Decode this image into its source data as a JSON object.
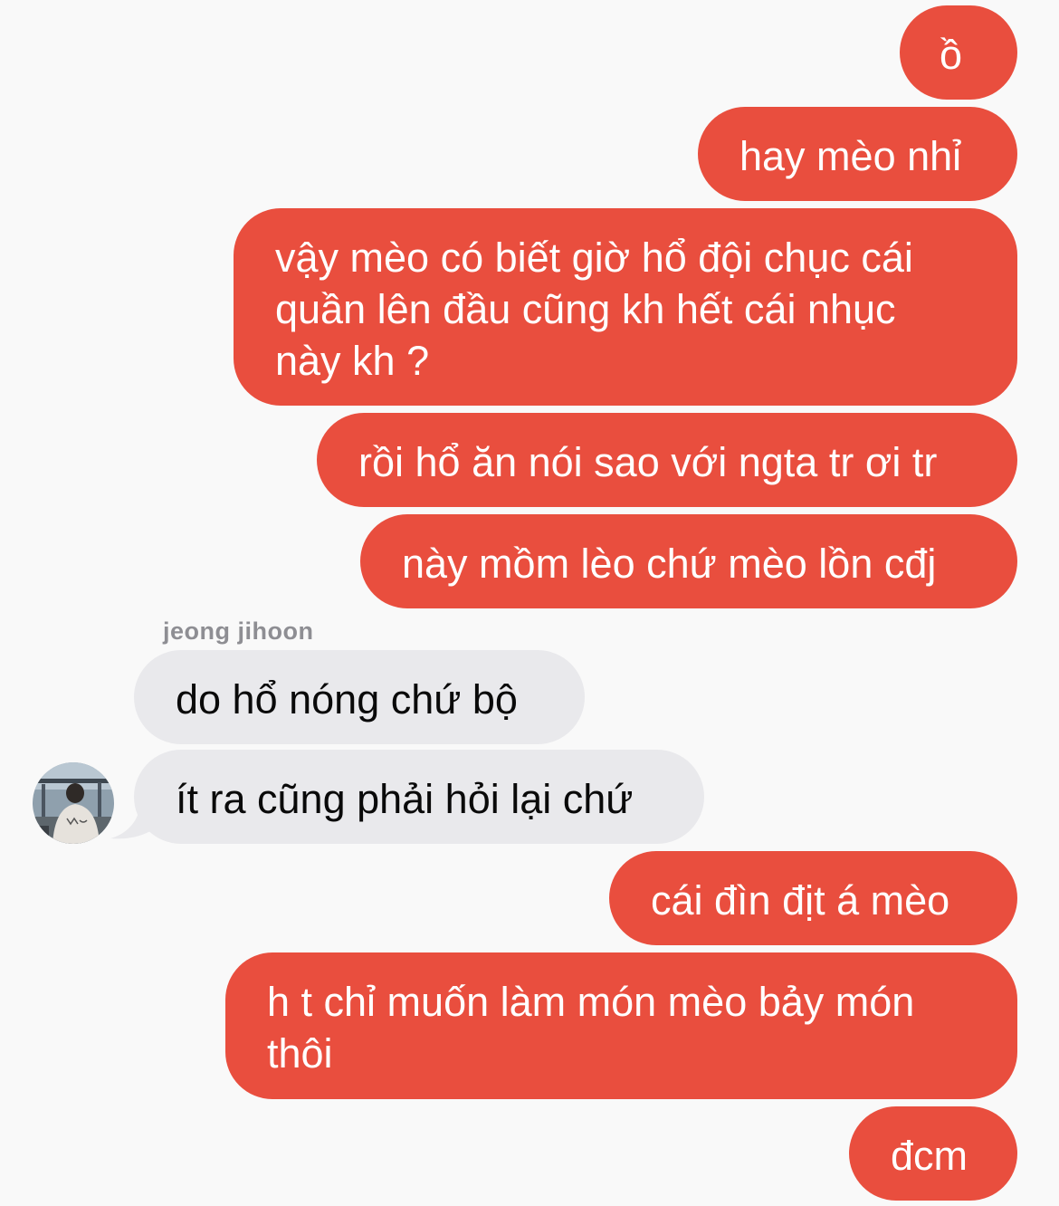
{
  "conversation": {
    "contact_name": "jeong jihoon",
    "messages": [
      {
        "from": "me",
        "text": "ồ"
      },
      {
        "from": "me",
        "text": "hay mèo nhỉ"
      },
      {
        "from": "me",
        "text": "vậy mèo có biết giờ hổ đội chục cái\nquần lên đầu cũng kh hết cái nhục\nnày kh ?"
      },
      {
        "from": "me",
        "text": "rồi hổ ăn nói sao với ngta tr ơi tr"
      },
      {
        "from": "me",
        "text": "này mồm lèo chứ mèo lồn cđj"
      },
      {
        "from": "contact",
        "text": "do hổ nóng chứ bộ"
      },
      {
        "from": "contact",
        "text": "ít ra cũng phải hỏi lại chứ"
      },
      {
        "from": "me",
        "text": "cái đìn địt á mèo"
      },
      {
        "from": "me",
        "text": "h t chỉ muốn làm món mèo bảy món\nthôi"
      },
      {
        "from": "me",
        "text": "đcm"
      }
    ]
  },
  "colors": {
    "sent_bubble": "#e94e3e",
    "received_bubble": "#e9e9ec",
    "background": "#f9f9f9"
  }
}
